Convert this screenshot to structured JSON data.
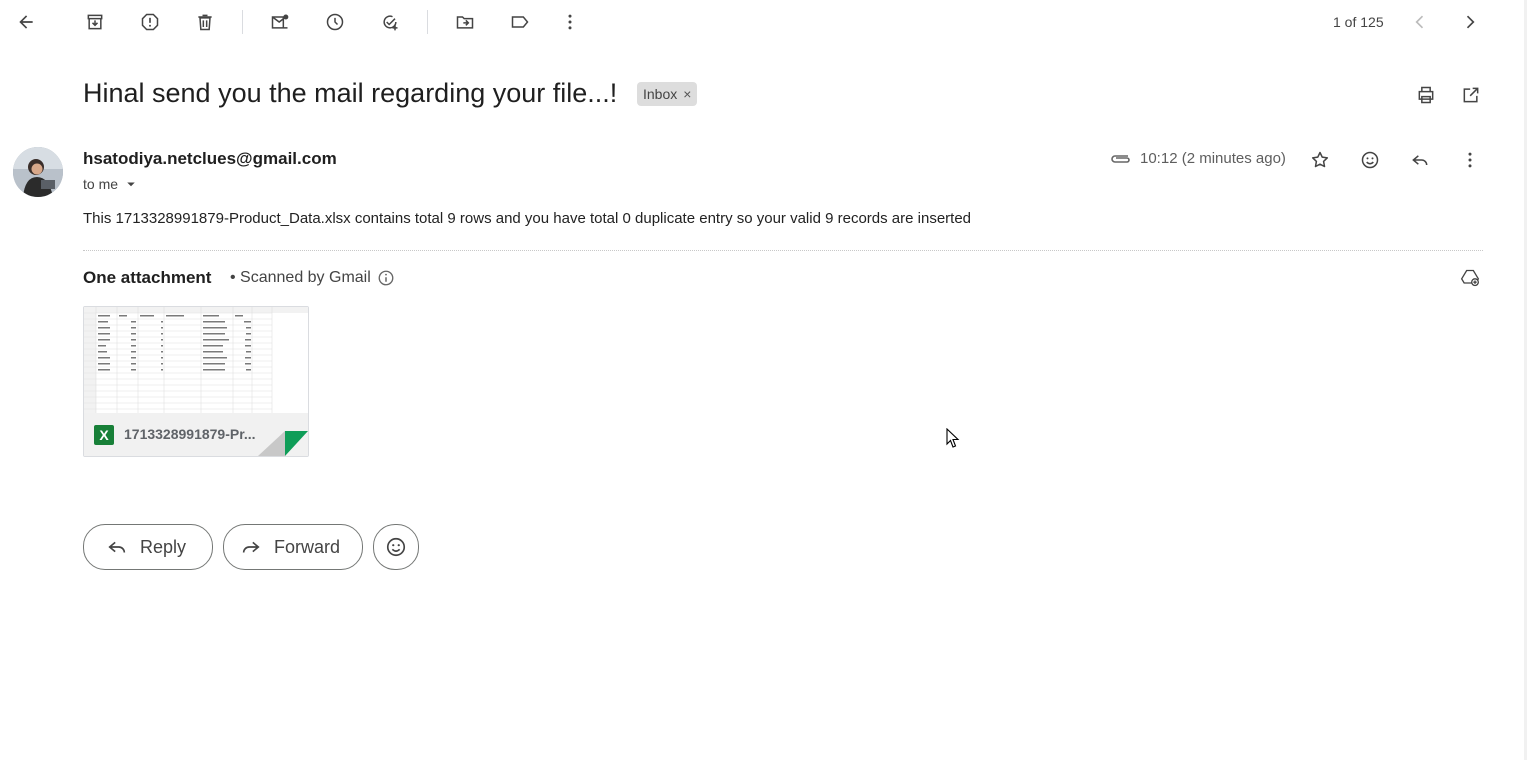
{
  "toolbar": {
    "icons": [
      "back-icon",
      "archive-icon",
      "report-spam-icon",
      "delete-icon",
      "mark-unread-icon",
      "snooze-icon",
      "add-to-tasks-icon",
      "move-to-icon",
      "label-icon",
      "more-vert-icon"
    ],
    "pagination": "1 of 125"
  },
  "email": {
    "subject": "Hinal send you the mail regarding your file...!",
    "label": "Inbox",
    "label_close": "×",
    "sender": "hsatodiya.netclues@gmail.com",
    "recipient": "to me",
    "time": "10:12 (2 minutes ago)",
    "body": "This 1713328991879-Product_Data.xlsx contains total 9 rows and you have total 0 duplicate entry so your valid 9 records are inserted"
  },
  "attachments": {
    "title": "One attachment",
    "scanned": "• Scanned by Gmail",
    "file_icon": "X",
    "file_name": "1713328991879-Pr..."
  },
  "actions": {
    "reply": "Reply",
    "forward": "Forward"
  },
  "colors": {
    "excel_green": "#188038",
    "label_chip_bg": "#dddddd"
  }
}
